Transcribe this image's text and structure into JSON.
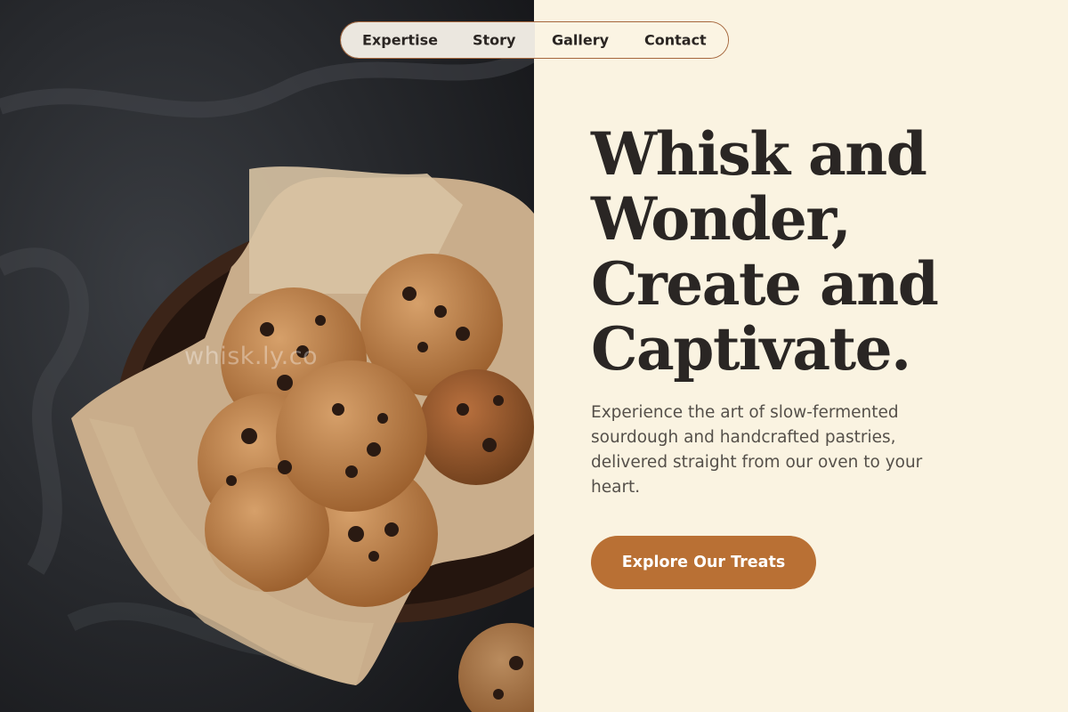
{
  "nav": {
    "items": [
      {
        "label": "Expertise"
      },
      {
        "label": "Story"
      },
      {
        "label": "Gallery"
      },
      {
        "label": "Contact"
      }
    ]
  },
  "hero": {
    "image_watermark": "whisk.ly.co",
    "title_lines": [
      "Whisk and",
      "Wonder,",
      "Create and",
      "Captivate."
    ],
    "subtitle": "Experience the art of slow-fermented sourdough and handcrafted pastries, delivered straight from our oven to your heart.",
    "cta_label": "Explore Our Treats"
  },
  "colors": {
    "background": "#faf3e1",
    "accent": "#b97034",
    "heading": "#2a2624",
    "nav_border": "#a5663c"
  }
}
